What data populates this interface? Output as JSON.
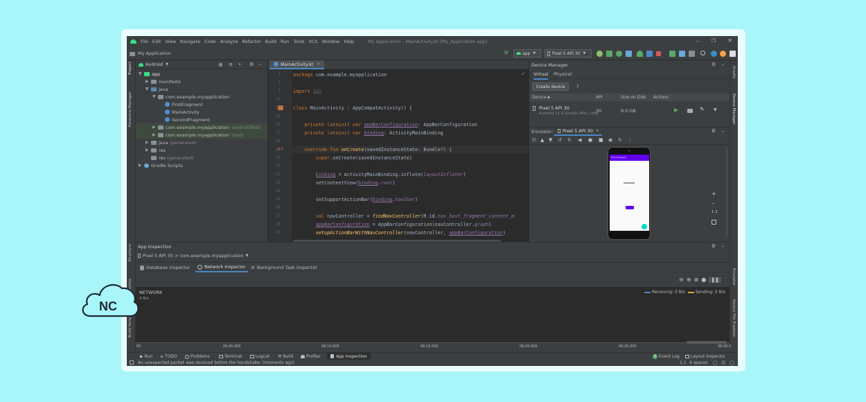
{
  "menu": [
    "File",
    "Edit",
    "View",
    "Navigate",
    "Code",
    "Analyze",
    "Refactor",
    "Build",
    "Run",
    "Tools",
    "VCS",
    "Window",
    "Help"
  ],
  "window_title": "My Application - MainActivity.kt [My_Application.app]",
  "toolbar": {
    "project": "My Application",
    "run_config": "app",
    "device": "Pixel 5 API 30"
  },
  "left_strip": {
    "project": "Project",
    "resource_manager": "Resource Manager",
    "structure": "Structure",
    "favorites": "Favorites",
    "build_variants": "Build Variants"
  },
  "right_strip": {
    "gradle": "Gradle",
    "device_manager": "Device Manager",
    "emulator": "Emulator",
    "device_file_explorer": "Device File Explorer"
  },
  "project_view": {
    "selector": "Android"
  },
  "tree": [
    {
      "label": "app",
      "extra": ""
    },
    {
      "label": "manifests",
      "extra": ""
    },
    {
      "label": "java",
      "extra": ""
    },
    {
      "label": "com.example.myapplication",
      "extra": ""
    },
    {
      "label": "FirstFragment",
      "extra": ""
    },
    {
      "label": "MainActivity",
      "extra": ""
    },
    {
      "label": "SecondFragment",
      "extra": ""
    },
    {
      "label": "com.example.myapplication",
      "extra": "(androidTest)"
    },
    {
      "label": "com.example.myapplication",
      "extra": "(test)"
    },
    {
      "label": "java",
      "extra": "(generated)"
    },
    {
      "label": "res",
      "extra": ""
    },
    {
      "label": "res",
      "extra": "(generated)"
    },
    {
      "label": "Gradle Scripts",
      "extra": ""
    }
  ],
  "editor": {
    "tab": "MainActivity.kt",
    "line_numbers": [
      "1",
      "2",
      "3",
      "13",
      "14",
      "15",
      "16",
      "17",
      "18",
      "19",
      "20",
      "21",
      "22",
      "23",
      "24",
      "25",
      "26",
      "27",
      "28",
      "29"
    ]
  },
  "device_manager": {
    "title": "Device Manager",
    "tabs": [
      "Virtual",
      "Physical"
    ],
    "create_button": "Create device",
    "help": "?",
    "columns": [
      "Device",
      "API",
      "Size on Disk",
      "Actions"
    ],
    "device": {
      "name": "Pixel 5 API 30",
      "subtitle": "Android 11.0 Google APIs | x86",
      "api": "30",
      "size": "9.0 GB"
    }
  },
  "emulator": {
    "label": "Emulator:",
    "tab": "Pixel 5 API 30",
    "screen_title": "First Fragment",
    "zoom": "1:1"
  },
  "app_inspection": {
    "title": "App Inspection",
    "process": "Pixel 5 API 30 > com.example.myapplication",
    "tabs": [
      "Database Inspector",
      "Network Inspector",
      "Background Task Inspector"
    ],
    "network_label": "NETWORK",
    "scale": "4 B/s",
    "receiving": "Receiving: 0 B/s",
    "sending": "Sending: 0 B/s",
    "time_ticks": [
      "00",
      "06:05.000",
      "06:10.000",
      "06:15.000",
      "06:20.000",
      "06:25.000",
      "06:30.0"
    ]
  },
  "bottom_tools": [
    "Run",
    "TODO",
    "Problems",
    "Terminal",
    "Logcat",
    "Build",
    "Profiler",
    "App Inspection"
  ],
  "bottom_right_tools": [
    "Event Log",
    "Layout Inspector"
  ],
  "event_log_count": "2",
  "status": {
    "message": "An unexpected packet was received before the handshake. (moments ago)",
    "position": "1:1",
    "indent": "4 spaces"
  },
  "overlay_logo": "NC",
  "colors": {
    "background": "#a8f6fa",
    "ide_dark": "#2b2b2b",
    "panel": "#3c3f41",
    "accent_blue": "#4a88c7",
    "receiving": "#4a88c7",
    "sending": "#e0a642"
  }
}
